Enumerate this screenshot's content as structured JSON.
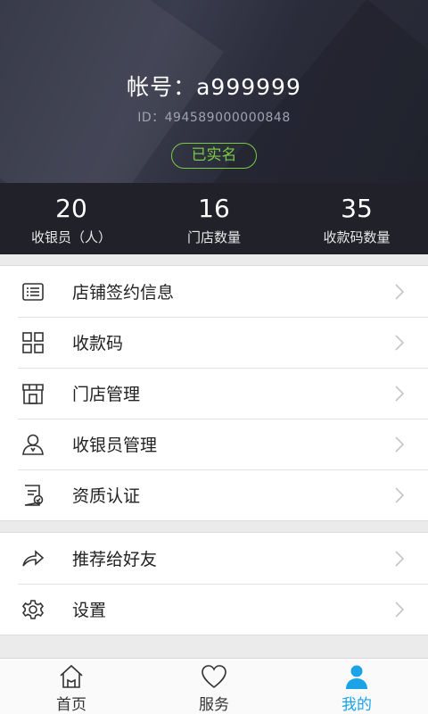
{
  "profile": {
    "account": "帐号：a999999",
    "id": "ID：494589000000848",
    "verified_badge": "已实名"
  },
  "stats": [
    {
      "value": "20",
      "label": "收银员（人）"
    },
    {
      "value": "16",
      "label": "门店数量"
    },
    {
      "value": "35",
      "label": "收款码数量"
    }
  ],
  "menu_group1": [
    {
      "label": "店铺签约信息",
      "icon": "store-contract-icon"
    },
    {
      "label": "收款码",
      "icon": "qr-code-icon"
    },
    {
      "label": "门店管理",
      "icon": "storefront-icon"
    },
    {
      "label": "收银员管理",
      "icon": "cashier-user-icon"
    },
    {
      "label": "资质认证",
      "icon": "certificate-icon"
    }
  ],
  "menu_group2": [
    {
      "label": "推荐给好友",
      "icon": "share-icon"
    },
    {
      "label": "设置",
      "icon": "gear-icon"
    }
  ],
  "nav": [
    {
      "label": "首页",
      "icon": "home-icon",
      "active": false
    },
    {
      "label": "服务",
      "icon": "heart-icon",
      "active": false
    },
    {
      "label": "我的",
      "icon": "profile-icon",
      "active": true
    }
  ],
  "colors": {
    "accent": "#1aa3e6",
    "verified": "#7ac943",
    "header_dark": "#2a2c3a",
    "stats_bar": "#202129"
  }
}
